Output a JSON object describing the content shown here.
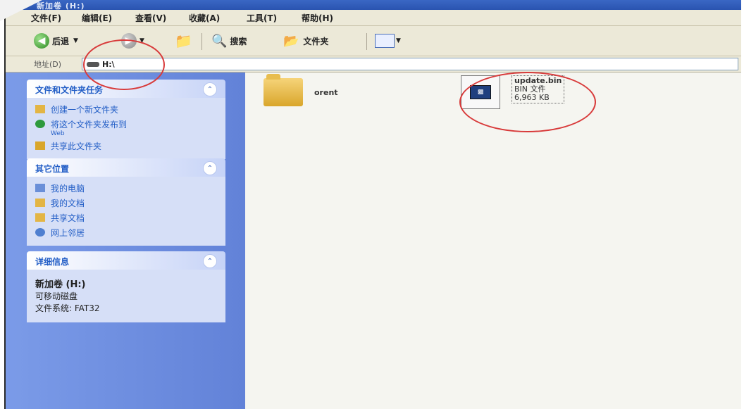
{
  "window": {
    "title": "新加卷 (H:)"
  },
  "menu": [
    "文件(F)",
    "编辑(E)",
    "查看(V)",
    "收藏(A)",
    "工具(T)",
    "帮助(H)"
  ],
  "toolbar": {
    "back_label": "后退",
    "search_label": "搜索",
    "folders_label": "文件夹"
  },
  "address": {
    "label": "地址(D)",
    "value": "H:\\"
  },
  "tasks_panel": {
    "title": "文件和文件夹任务",
    "items": [
      {
        "label": "创建一个新文件夹"
      },
      {
        "label": "将这个文件夹发布到",
        "sub": "Web"
      },
      {
        "label": "共享此文件夹"
      }
    ]
  },
  "places_panel": {
    "title": "其它位置",
    "items": [
      {
        "label": "我的电脑"
      },
      {
        "label": "我的文档"
      },
      {
        "label": "共享文档"
      },
      {
        "label": "网上邻居"
      }
    ]
  },
  "details_panel": {
    "title": "详细信息",
    "drive_name": "新加卷 (H:)",
    "drive_type": "可移动磁盘",
    "filesystem": "文件系统: FAT32"
  },
  "files": [
    {
      "name": "orent",
      "type": "folder"
    },
    {
      "name": "update.bin",
      "type_label": "BIN 文件",
      "size": "6,963 KB"
    }
  ],
  "colors": {
    "accent_blue": "#215dc6",
    "sidebar": "#6282d8",
    "annotation_red": "#d83a3a"
  }
}
